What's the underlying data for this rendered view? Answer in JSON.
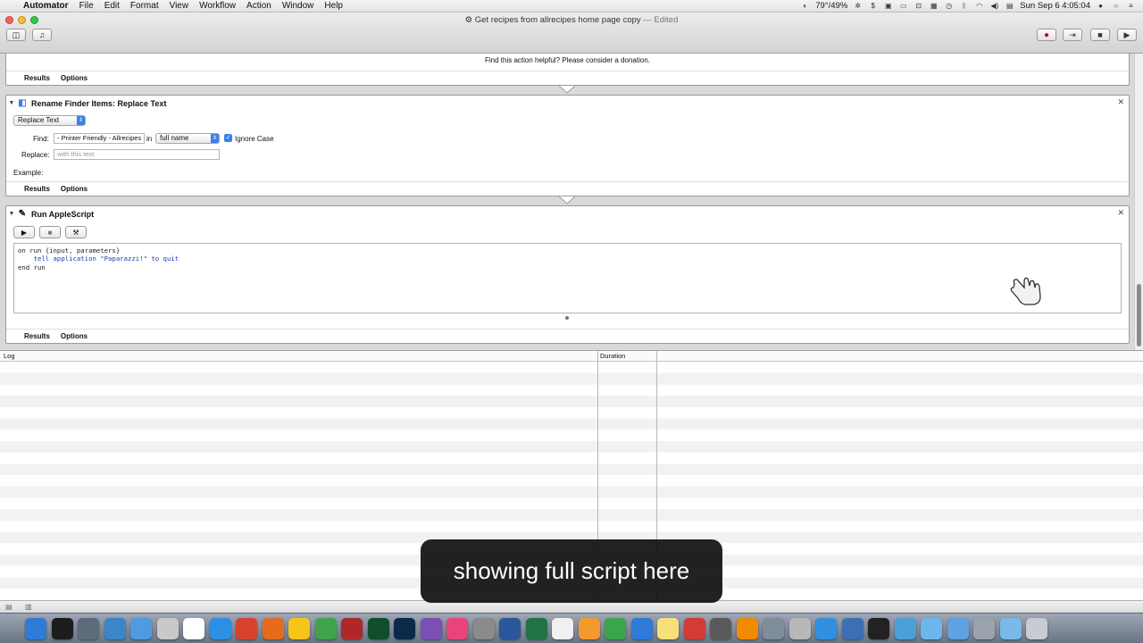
{
  "menubar": {
    "app_name": "Automator",
    "menus": [
      "File",
      "Edit",
      "Format",
      "View",
      "Workflow",
      "Action",
      "Window",
      "Help"
    ],
    "status": {
      "battery": "79°/49%",
      "time": "Sun Sep 6  4:05:04"
    }
  },
  "window": {
    "title": "Get recipes from allrecipes home page copy",
    "edited": "— Edited"
  },
  "toolbar": {
    "library_label": "Library",
    "media_label": "Media",
    "record_label": "Record",
    "step_label": "Step",
    "stop_label": "Stop",
    "run_label": "Run"
  },
  "top_action": {
    "donation": "Find this action helpful? Please consider a donation.",
    "results": "Results",
    "options": "Options"
  },
  "rename_action": {
    "title": "Rename Finder Items: Replace Text",
    "mode": "Replace Text",
    "find_label": "Find:",
    "find_value": "- Printer Friendly - Allrecipes",
    "in_label": "in",
    "scope": "full name",
    "ignore_case": "Ignore Case",
    "replace_label": "Replace:",
    "replace_placeholder": "with this text",
    "example_label": "Example:",
    "results": "Results",
    "options": "Options"
  },
  "applescript_action": {
    "title": "Run AppleScript",
    "script_lines": [
      "on run {input, parameters}",
      "    tell application \"Paparazzi!\" to quit",
      "end run"
    ],
    "results": "Results",
    "options": "Options"
  },
  "log": {
    "col_log": "Log",
    "col_duration": "Duration"
  },
  "caption": "showing full script here",
  "dock_items": [
    "Finder",
    "Dashboard",
    "Launchpad",
    "Preview",
    "Mail",
    "Contacts",
    "Calendar",
    "Safari",
    "Chrome",
    "Firefox",
    "Cyberduck",
    "Adium",
    "FileZilla",
    "Dreamweaver",
    "Photoshop",
    "Pixelmator",
    "iTunes",
    "Automator",
    "Word",
    "Excel",
    "TextEdit",
    "Pages",
    "Numbers",
    "Keynote",
    "Notes",
    "Wunderlist",
    "iMovie",
    "VLC",
    "Utilities",
    "Scripts",
    "Downloads",
    "Network",
    "Terminal",
    "Apps",
    "Folder",
    "Documents",
    "Tools",
    "Files",
    "Trash"
  ],
  "colors": {
    "accent": "#3b82e8",
    "workflow_bg": "#d9d9d9",
    "dock": "#7a8394"
  }
}
